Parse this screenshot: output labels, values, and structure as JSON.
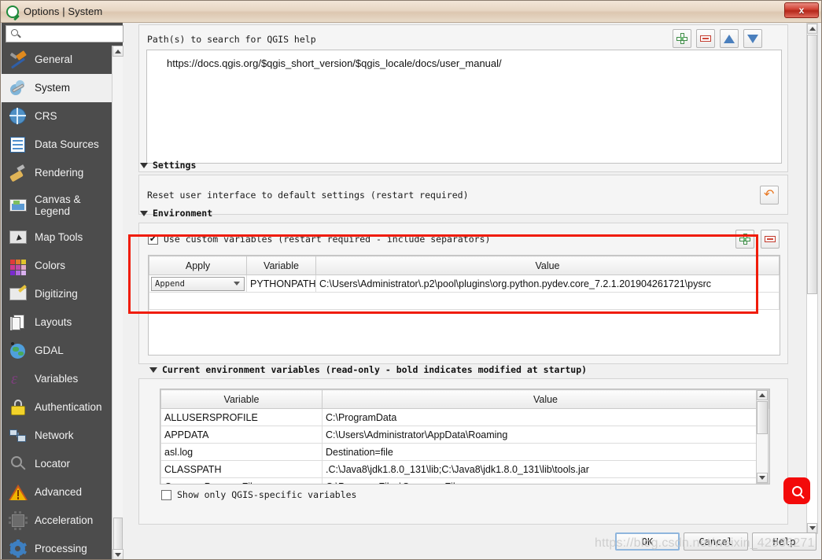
{
  "window": {
    "title": "Options | System",
    "app_icon": "qgis-logo-icon",
    "close_label": "x"
  },
  "sidebar": {
    "search": {
      "value": "",
      "placeholder": ""
    },
    "items": [
      {
        "label": "General",
        "icon": "hammer-icon",
        "selected": false
      },
      {
        "label": "System",
        "icon": "wrench-gears-icon",
        "selected": true
      },
      {
        "label": "CRS",
        "icon": "globe-grid-icon",
        "selected": false
      },
      {
        "label": "Data Sources",
        "icon": "table-icon",
        "selected": false
      },
      {
        "label": "Rendering",
        "icon": "paintbrush-icon",
        "selected": false
      },
      {
        "label": "Canvas & Legend",
        "icon": "canvas-icon",
        "selected": false
      },
      {
        "label": "Map Tools",
        "icon": "map-cursor-icon",
        "selected": false
      },
      {
        "label": "Colors",
        "icon": "color-swatch-icon",
        "selected": false
      },
      {
        "label": "Digitizing",
        "icon": "map-pencil-icon",
        "selected": false
      },
      {
        "label": "Layouts",
        "icon": "pages-ruler-icon",
        "selected": false
      },
      {
        "label": "GDAL",
        "icon": "globe-star-icon",
        "selected": false
      },
      {
        "label": "Variables",
        "icon": "epsilon-icon",
        "selected": false
      },
      {
        "label": "Authentication",
        "icon": "padlock-icon",
        "selected": false
      },
      {
        "label": "Network",
        "icon": "network-icon",
        "selected": false
      },
      {
        "label": "Locator",
        "icon": "magnifier-icon",
        "selected": false
      },
      {
        "label": "Advanced",
        "icon": "warning-triangle-icon",
        "selected": false
      },
      {
        "label": "Acceleration",
        "icon": "chip-icon",
        "selected": false
      },
      {
        "label": "Processing",
        "icon": "gear-icon",
        "selected": false
      }
    ]
  },
  "help_paths": {
    "label": "Path(s) to search for QGIS help",
    "entries": [
      "https://docs.qgis.org/$qgis_short_version/$qgis_locale/docs/user_manual/"
    ],
    "buttons": [
      {
        "name": "add-path-button",
        "icon": "plus-icon"
      },
      {
        "name": "remove-path-button",
        "icon": "minus-icon"
      },
      {
        "name": "move-path-up-button",
        "icon": "triangle-up-icon"
      },
      {
        "name": "move-path-down-button",
        "icon": "triangle-down-icon"
      }
    ]
  },
  "settings": {
    "header": "Settings",
    "reset_label": "Reset user interface to default settings (restart required)",
    "reset_icon": "undo-arrow-icon"
  },
  "environment": {
    "header": "Environment",
    "use_custom_label": "Use custom variables (restart required - include separators)",
    "use_custom_checked": true,
    "buttons": [
      {
        "name": "add-variable-button",
        "icon": "plus-icon"
      },
      {
        "name": "remove-variable-button",
        "icon": "minus-icon"
      }
    ],
    "columns": [
      "Apply",
      "Variable",
      "Value"
    ],
    "rows": [
      {
        "apply": "Append",
        "variable": "PYTHONPATH",
        "value": "C:\\Users\\Administrator\\.p2\\pool\\plugins\\org.python.pydev.core_7.2.1.201904261721\\pysrc"
      }
    ]
  },
  "current_environment": {
    "header": "Current environment variables (read-only - bold indicates modified at startup)",
    "columns": [
      "Variable",
      "Value"
    ],
    "rows": [
      {
        "variable": "ALLUSERSPROFILE",
        "value": "C:\\ProgramData"
      },
      {
        "variable": "APPDATA",
        "value": "C:\\Users\\Administrator\\AppData\\Roaming"
      },
      {
        "variable": "asl.log",
        "value": "Destination=file"
      },
      {
        "variable": "CLASSPATH",
        "value": ".C:\\Java8\\jdk1.8.0_131\\lib;C:\\Java8\\jdk1.8.0_131\\lib\\tools.jar"
      },
      {
        "variable": "CommonProgramFiles",
        "value": "C:\\Program Files\\Common Files"
      }
    ],
    "show_only_qgis_label": "Show only QGIS-specific variables",
    "show_only_qgis_checked": false
  },
  "dialog_buttons": [
    {
      "label": "OK",
      "name": "ok-button",
      "default": true
    },
    {
      "label": "Cancel",
      "name": "cancel-button",
      "default": false
    },
    {
      "label": "Help",
      "name": "help-button",
      "default": false
    }
  ],
  "overlays": {
    "watermark": "https://blog.csdn.net/weixin_42936271",
    "float_search_icon": "magnifier-icon",
    "highlight_color": "#f01c0a"
  }
}
